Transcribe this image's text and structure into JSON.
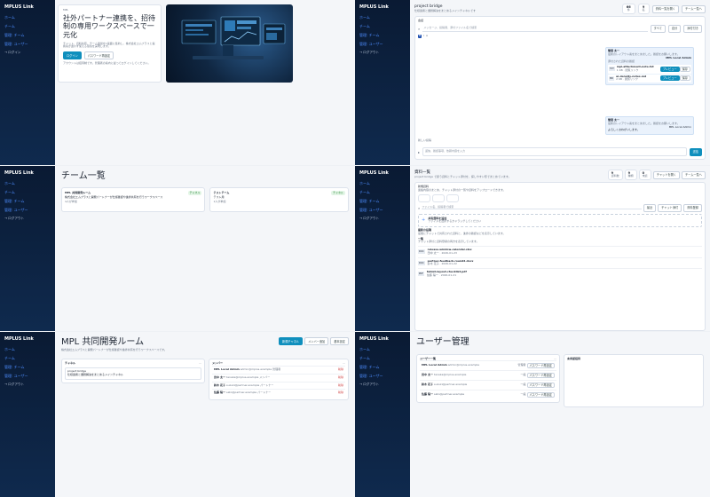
{
  "nav": {
    "brand": "MPLUS Link",
    "items": [
      "ホーム",
      "チーム",
      "管理: チーム",
      "管理: ユーザー"
    ],
    "logout": "ログアウト",
    "login": "ログイン"
  },
  "landing": {
    "eyebrow": "MPL",
    "title": "社外パートナー連携を、招待制の専用ワークスペースで一元化",
    "desc": "チャット、資料共有、チーム運営を1画面に集約し、株式会社エムプラスと提携先が迷わず使える環境を実現します。",
    "login_button": "ログイン",
    "reset_button": "パスワード再設定",
    "note": "アカウントは招待制です。管理者の案内に従ってログインしてください。"
  },
  "chat": {
    "room_title": "project bridge",
    "room_sub": "仕様連携と課題解決をまとめるメインチャネルです",
    "stats": [
      {
        "v": "66",
        "l": "件"
      },
      {
        "v": "9",
        "l": "名"
      }
    ],
    "btn_files": "資料一覧を開く",
    "btn_back": "チーム一覧へ",
    "section_label": "会話",
    "search_placeholder": "メッセージ、投稿者、添付ファイル名で検索",
    "filters": [
      "すべて",
      "自分",
      "添付付き"
    ],
    "msg_author": "管理 太一",
    "msg_text": "最新のレイアウト案をまとめました。確認をお願いします。",
    "msg_meta": "MPL Local Admin",
    "attachments_title": "添付された資料の確認",
    "attachments": [
      {
        "ext": "TXT",
        "name": "mpl-attachment-note.txt",
        "meta": "1 KB · 閲覧リンク"
      },
      {
        "ext": "MD",
        "name": "ui-density-notes.md",
        "meta": "2 KB · 閲覧リンク"
      }
    ],
    "preview": "プレビュー",
    "download": "保存",
    "reply_text": "よろしくおねがいします。",
    "input_placeholder": "返信、確認事項、依頼内容を入力",
    "send": "送信",
    "new_msg": "新しい投稿"
  },
  "teams": {
    "title": "チーム一覧",
    "cards": [
      {
        "name": "MPL 共同開発ルーム",
        "tag": "チャネル",
        "desc": "株式会社エムプラスと開発パートナーが仕様確認や進捗共有を行うワークスペース",
        "members": "4人が参加"
      },
      {
        "name": "テストチーム",
        "tag": "チャネル",
        "desc": "テスト用",
        "members": "1人が参加"
      }
    ]
  },
  "files": {
    "title": "資料一覧",
    "sub": "project bridge で扱う資料とチャット添付を、探しやすい形でまとめています。",
    "stats": [
      {
        "v": "9",
        "l": "資料数"
      },
      {
        "v": "9",
        "l": "種類"
      },
      {
        "v": "0",
        "l": "未読"
      }
    ],
    "btn_chat": "チャットを開く",
    "btn_back": "チーム一覧へ",
    "upload_title": "新規資料",
    "upload_desc": "連絡内容のまとめ、チャット添付の一覧や資料をアップロードできます。",
    "search_placeholder": "ファイル名、投稿者で検索",
    "filter_buttons": [
      "最近",
      "チャット添付",
      "資料登録"
    ],
    "drop_title": "共有資料を追加",
    "drop_desc": "ファイルを選択するかドラッグしてください",
    "recent_title": "最新の投稿",
    "recent_desc": "最後にチャットで共有された資料と、進捗の確認などを表示しています。",
    "list_title": "一覧",
    "list_desc": "チャット添付と資料登録の両方を表示しています。",
    "items": [
      {
        "ext": "DOC",
        "name": "release-window-calendar.xlsx",
        "meta": "田中 太一 · 2026-01-23"
      },
      {
        "ext": "DOC",
        "name": "partner-feedback-round2.docx",
        "meta": "鈴木 花子 · 2026-01-22"
      },
      {
        "ext": "PDF",
        "name": "tablet-layout-checklist.pdf",
        "meta": "佐藤 陽一 · 2026-01-21"
      }
    ]
  },
  "room": {
    "title": "MPL 共同開発ルーム",
    "desc": "株式会社エムプラスと開発パートナーが仕様確認や進捗共有を行うワークスペースです。",
    "btn_new": "新規チャネル",
    "btn_add": "メンバー追加",
    "btn_edit": "基本設定",
    "channels_label": "チャネル",
    "channel_name": "project bridge",
    "channel_desc": "仕様連携と課題解決をまとめるメインチャネル",
    "members_label": "メンバー",
    "members": [
      {
        "name": "MPL Local Admin",
        "email": "admin@mplus.example",
        "role": "管理者",
        "action": "削除"
      },
      {
        "name": "田中 太一",
        "email": "tanaka@mplus.example",
        "role": "メンバー",
        "action": "削除"
      },
      {
        "name": "鈴木 花子",
        "email": "suzuki@partner.example",
        "role": "パートナー",
        "action": "削除"
      },
      {
        "name": "佐藤 陽一",
        "email": "sato@partner.example",
        "role": "パートナー",
        "action": "削除"
      }
    ]
  },
  "users": {
    "title": "ユーザー管理",
    "list_label": "ユーザー一覧",
    "detail_label": "未承認招待",
    "rows": [
      {
        "name": "MPL Local Admin",
        "email": "admin@mplus.example",
        "role": "管理者",
        "action": "パスワード再設定"
      },
      {
        "name": "田中 太一",
        "email": "tanaka@mplus.example",
        "role": "一般",
        "action": "パスワード再設定"
      },
      {
        "name": "鈴木 花子",
        "email": "suzuki@partner.example",
        "role": "一般",
        "action": "パスワード再設定"
      },
      {
        "name": "佐藤 陽一",
        "email": "sato@partner.example",
        "role": "一般",
        "action": "パスワード再設定"
      }
    ]
  }
}
